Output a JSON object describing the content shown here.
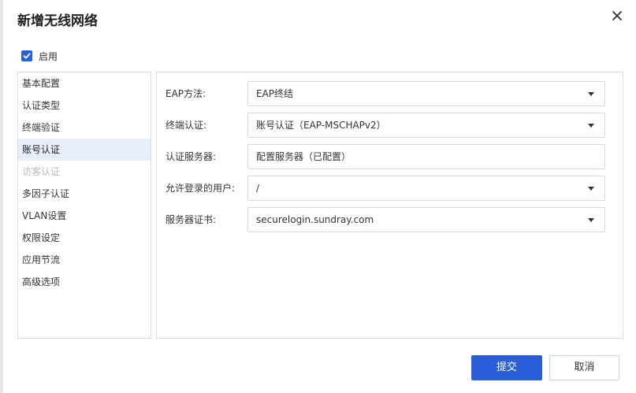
{
  "dialog": {
    "title": "新增无线网络",
    "enable_label": "启用",
    "enable_checked": true
  },
  "nav": {
    "items": [
      {
        "label": "基本配置",
        "state": "normal"
      },
      {
        "label": "认证类型",
        "state": "normal"
      },
      {
        "label": "终端验证",
        "state": "normal"
      },
      {
        "label": "账号认证",
        "state": "active"
      },
      {
        "label": "访客认证",
        "state": "disabled"
      },
      {
        "label": "多因子认证",
        "state": "normal"
      },
      {
        "label": "VLAN设置",
        "state": "normal"
      },
      {
        "label": "权限设定",
        "state": "normal"
      },
      {
        "label": "应用节流",
        "state": "normal"
      },
      {
        "label": "高级选项",
        "state": "normal"
      }
    ]
  },
  "form": {
    "eap_method": {
      "label": "EAP方法:",
      "value": "EAP终结"
    },
    "terminal_auth": {
      "label": "终端认证:",
      "value": "账号认证（EAP-MSCHAPv2）"
    },
    "auth_server": {
      "label": "认证服务器:",
      "value": "配置服务器（已配置）"
    },
    "allowed_users": {
      "label": "允许登录的用户:",
      "value": "/"
    },
    "server_cert": {
      "label": "服务器证书:",
      "value": "securelogin.sundray.com"
    }
  },
  "footer": {
    "submit_label": "提交",
    "cancel_label": "取消"
  },
  "colors": {
    "accent": "#2b5fd9",
    "active_nav_bg": "#e8eef9",
    "disabled_text": "#b9b9b9"
  }
}
